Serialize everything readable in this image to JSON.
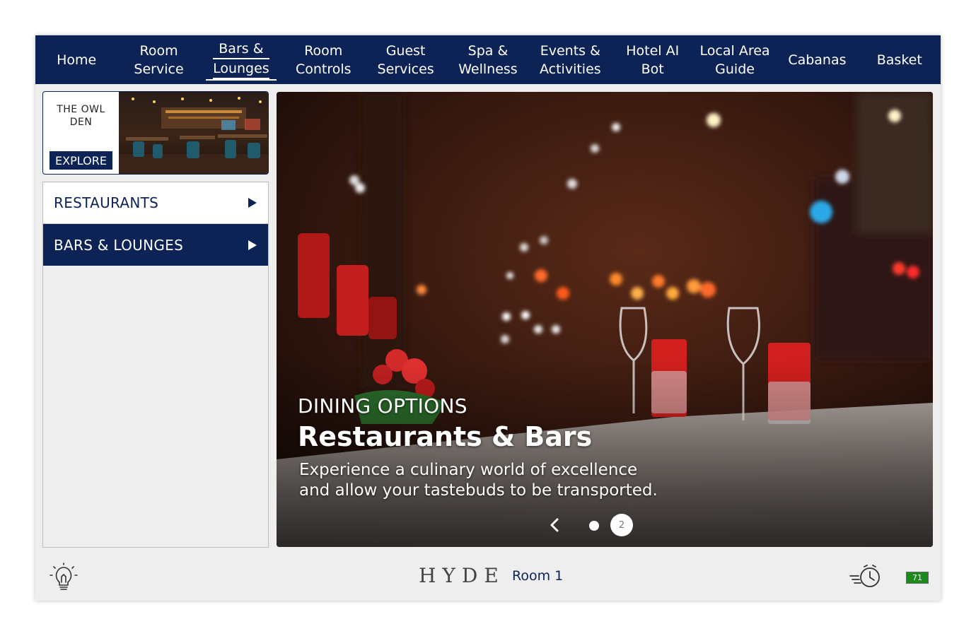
{
  "nav": {
    "items": [
      {
        "line1": "Home",
        "line2": ""
      },
      {
        "line1": "Room",
        "line2": "Service"
      },
      {
        "line1": "Bars &",
        "line2": "Lounges"
      },
      {
        "line1": "Room",
        "line2": "Controls"
      },
      {
        "line1": "Guest",
        "line2": "Services"
      },
      {
        "line1": "Spa &",
        "line2": "Wellness"
      },
      {
        "line1": "Events &",
        "line2": "Activities"
      },
      {
        "line1": "Hotel AI",
        "line2": "Bot"
      },
      {
        "line1": "Local Area",
        "line2": "Guide"
      },
      {
        "line1": "Cabanas",
        "line2": ""
      },
      {
        "line1": "Basket",
        "line2": ""
      }
    ],
    "active_index": 2
  },
  "sidebar": {
    "feature": {
      "name": "THE OWL DEN",
      "button_label": "EXPLORE"
    },
    "menu": [
      {
        "label": "RESTAURANTS",
        "active": false
      },
      {
        "label": "BARS & LOUNGES",
        "active": true
      }
    ]
  },
  "hero": {
    "eyebrow": "DINING OPTIONS",
    "title": "Restaurants & Bars",
    "desc_line1": "Experience a culinary world of excellence",
    "desc_line2": "and allow your tastebuds to be transported.",
    "current_slide_label": "2"
  },
  "footer": {
    "brand": "HYDE",
    "room": "Room 1",
    "battery": "71",
    "icons": [
      "lightbulb-icon",
      "alarm-clock-icon",
      "battery-icon"
    ]
  },
  "colors": {
    "navy": "#0d2355",
    "battery_green": "#1b8a1b"
  }
}
